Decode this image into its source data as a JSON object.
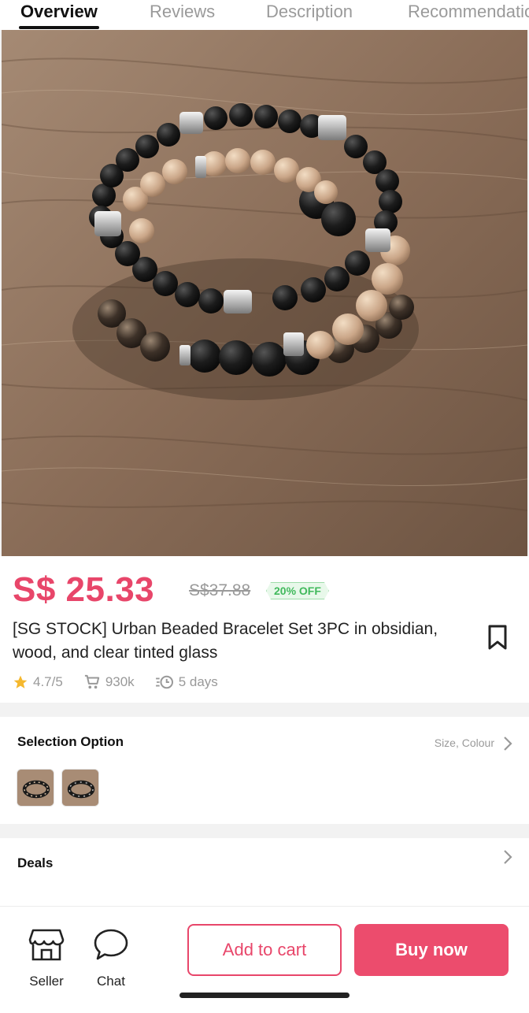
{
  "tabs": [
    {
      "label": "Overview",
      "active": true
    },
    {
      "label": "Reviews",
      "active": false
    },
    {
      "label": "Description",
      "active": false
    },
    {
      "label": "Recommendations",
      "active": false
    }
  ],
  "product": {
    "price": "S$ 25.33",
    "original_price": "S$37.88",
    "discount": "20% OFF",
    "title": "[SG STOCK] Urban Beaded Bracelet Set 3PC in obsidian, wood, and clear tinted glass",
    "rating": "4.7/5",
    "sold": "930k",
    "delivery": "5 days"
  },
  "selection": {
    "title": "Selection Option",
    "hint": "Size, Colour"
  },
  "deals": {
    "title": "Deals"
  },
  "bottom_bar": {
    "seller_label": "Seller",
    "chat_label": "Chat",
    "add_to_cart_label": "Add to cart",
    "buy_now_label": "Buy now"
  },
  "colors": {
    "accent": "#e8466a",
    "discount_green": "#41b95c",
    "star": "#f5b82e"
  },
  "icons": [
    "bookmark-icon",
    "star-icon",
    "cart-icon",
    "delivery-time-icon",
    "chevron-right-icon",
    "store-icon",
    "chat-icon"
  ]
}
